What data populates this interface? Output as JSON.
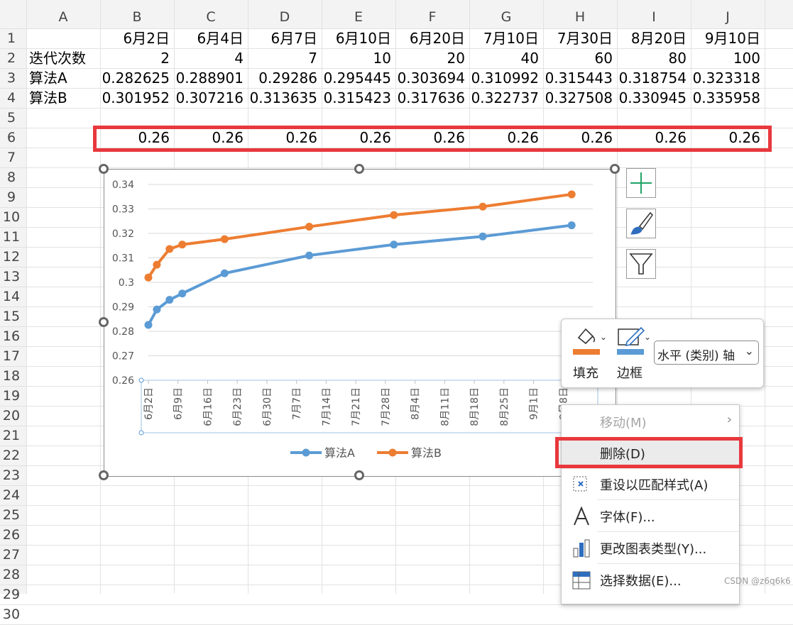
{
  "columns": [
    "A",
    "B",
    "C",
    "D",
    "E",
    "F",
    "G",
    "H",
    "I",
    "J"
  ],
  "rows": [
    "1",
    "2",
    "3",
    "4",
    "5",
    "6",
    "7",
    "8",
    "9",
    "10",
    "11",
    "12",
    "13",
    "14",
    "15",
    "16",
    "17",
    "18",
    "19",
    "20",
    "21",
    "22",
    "23",
    "24",
    "25",
    "26",
    "27",
    "28",
    "29",
    "30"
  ],
  "sheet": {
    "row1": [
      "",
      "6月2日",
      "6月4日",
      "6月7日",
      "6月10日",
      "6月20日",
      "7月10日",
      "7月30日",
      "8月20日",
      "9月10日"
    ],
    "row2": [
      "迭代次数",
      "2",
      "4",
      "7",
      "10",
      "20",
      "40",
      "60",
      "80",
      "100"
    ],
    "row3": [
      "算法A",
      "0.282625",
      "0.288901",
      "0.29286",
      "0.295445",
      "0.303694",
      "0.310992",
      "0.315443",
      "0.318754",
      "0.323318"
    ],
    "row4": [
      "算法B",
      "0.301952",
      "0.307216",
      "0.313635",
      "0.315423",
      "0.317636",
      "0.322737",
      "0.327508",
      "0.330945",
      "0.335958"
    ],
    "row6": [
      "",
      "0.26",
      "0.26",
      "0.26",
      "0.26",
      "0.26",
      "0.26",
      "0.26",
      "0.26",
      "0.26"
    ]
  },
  "chart_data": {
    "type": "line",
    "title": "",
    "x": [
      "6月2日",
      "6月4日",
      "6月7日",
      "6月10日",
      "6月20日",
      "7月10日",
      "7月30日",
      "8月20日",
      "9月10日"
    ],
    "x_days": [
      0,
      2,
      5,
      8,
      18,
      38,
      58,
      79,
      100
    ],
    "series": [
      {
        "name": "算法A",
        "color": "#5b9bd5",
        "values": [
          0.282625,
          0.288901,
          0.29286,
          0.295445,
          0.303694,
          0.310992,
          0.315443,
          0.318754,
          0.323318
        ]
      },
      {
        "name": "算法B",
        "color": "#ed7d31",
        "values": [
          0.301952,
          0.307216,
          0.313635,
          0.315423,
          0.317636,
          0.322737,
          0.327508,
          0.330945,
          0.335958
        ]
      }
    ],
    "ylim": [
      0.26,
      0.34
    ],
    "yticks": [
      "0.34",
      "0.33",
      "0.32",
      "0.31",
      "0.3",
      "0.29",
      "0.28",
      "0.27",
      "0.26"
    ],
    "xticks": [
      "6月2日",
      "6月9日",
      "6月16日",
      "6月23日",
      "6月30日",
      "7月7日",
      "7月14日",
      "7月21日",
      "7月28日",
      "8月4日",
      "8月11日",
      "8月18日",
      "8月25日",
      "9月1日",
      "9月8日"
    ],
    "legend": "bottom",
    "grid": true
  },
  "chart_tools": {
    "add_element": "plus-icon",
    "styles": "brush-icon",
    "filters": "funnel-icon"
  },
  "format_toolbar": {
    "fill_label": "填充",
    "border_label": "边框",
    "element_select": "水平 (类别) 轴",
    "fill_color": "#ed7d31",
    "border_color": "#5b9bd5"
  },
  "context_menu": [
    {
      "label": "移动(M)",
      "disabled": true,
      "icon": ""
    },
    {
      "label": "删除(D)",
      "disabled": false,
      "icon": ""
    },
    {
      "label": "重设以匹配样式(A)",
      "disabled": false,
      "icon": "reset-style-icon"
    },
    {
      "label": "字体(F)...",
      "disabled": false,
      "icon": "font-icon"
    },
    {
      "label": "更改图表类型(Y)...",
      "disabled": false,
      "icon": "chart-type-icon"
    },
    {
      "label": "选择数据(E)...",
      "disabled": false,
      "icon": "select-data-icon"
    }
  ],
  "watermark": "CSDN @z6q6k6",
  "highlight_color": "#e8383d"
}
